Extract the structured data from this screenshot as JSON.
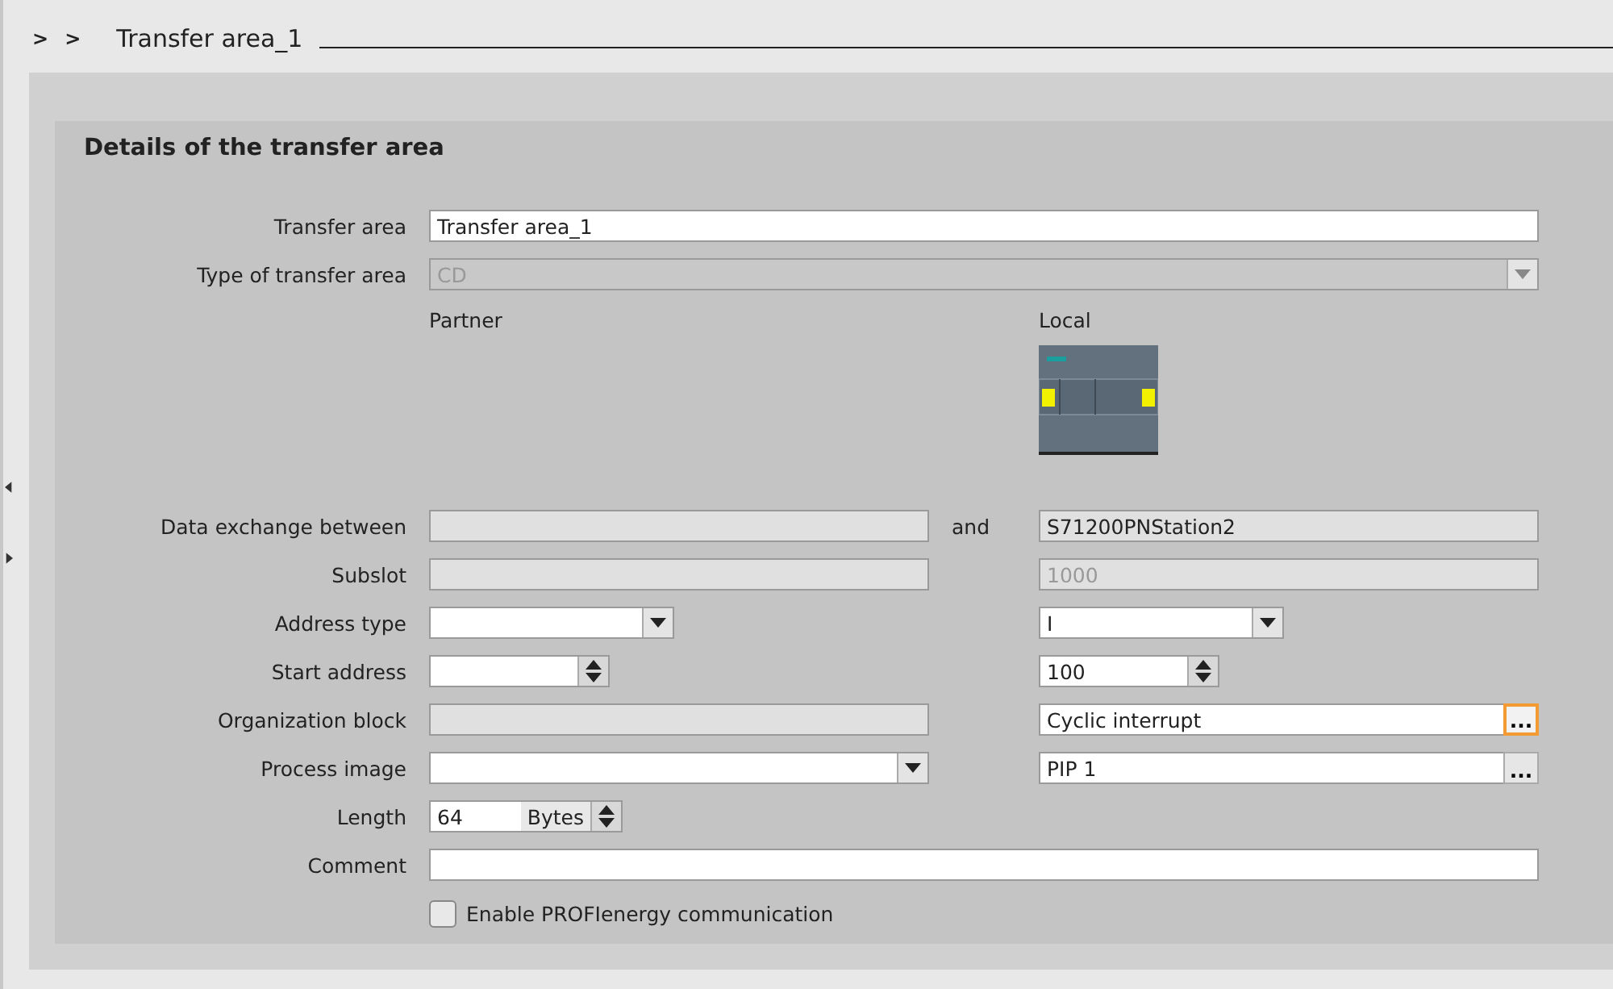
{
  "breadcrumb": {
    "arrows": [
      ">",
      ">"
    ],
    "title": "Transfer area_1"
  },
  "section": {
    "title": "Details of the transfer area"
  },
  "top_rows": [
    {
      "label": "Transfer area",
      "field": {
        "kind": "text",
        "value": "Transfer area_1"
      }
    },
    {
      "label": "Type of transfer area",
      "field": {
        "kind": "combo",
        "value": "CD",
        "disabled": true
      }
    }
  ],
  "columns": {
    "partner": "Partner",
    "local": "Local"
  },
  "rows": [
    {
      "label": "Data exchange between",
      "connector": "and",
      "partner": {
        "kind": "readonly"
      },
      "local": {
        "kind": "readonly",
        "value": "S71200PNStation2"
      }
    },
    {
      "label": "Subslot",
      "partner": {
        "kind": "readonly"
      },
      "local": {
        "kind": "readonly",
        "value": "1000",
        "disabled": true
      }
    },
    {
      "label": "Address type",
      "partner": {
        "kind": "combo"
      },
      "local": {
        "kind": "combo",
        "value": "I"
      }
    },
    {
      "label": "Start address",
      "partner": {
        "kind": "spin"
      },
      "local": {
        "kind": "spin",
        "value": "100"
      }
    },
    {
      "label": "Organization block",
      "partner": {
        "kind": "readonly"
      },
      "local": {
        "kind": "browse",
        "value": "Cyclic interrupt",
        "button": "...",
        "highlighted": true
      }
    },
    {
      "label": "Process image",
      "partner": {
        "kind": "combo"
      },
      "local": {
        "kind": "browse",
        "value": "PIP 1",
        "button": "...",
        "highlighted": false
      }
    },
    {
      "label": "Length",
      "partner": {
        "kind": "length",
        "value": "64",
        "unit": "Bytes"
      }
    },
    {
      "label": "Comment",
      "partner": {
        "kind": "text"
      }
    }
  ],
  "checkbox": {
    "label": "Enable PROFIenergy communication",
    "checked": false
  }
}
